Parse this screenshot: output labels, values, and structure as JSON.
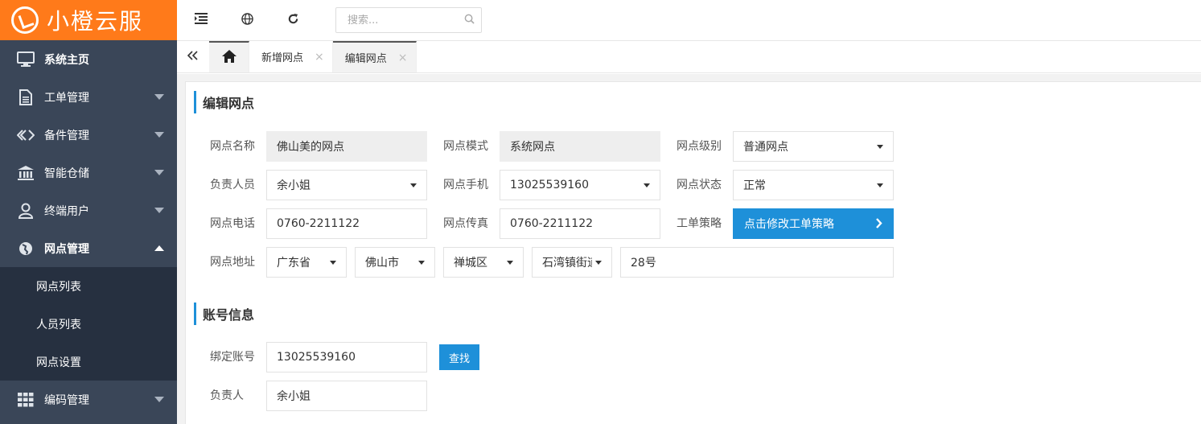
{
  "app": {
    "brand": "小橙云服"
  },
  "sidebar": {
    "items": [
      {
        "label": "系统主页",
        "icon": "monitor-icon",
        "has_caret": false,
        "bold": true
      },
      {
        "label": "工单管理",
        "icon": "document-icon",
        "has_caret": true
      },
      {
        "label": "备件管理",
        "icon": "diamond-link-icon",
        "has_caret": true
      },
      {
        "label": "智能仓储",
        "icon": "bank-icon",
        "has_caret": true
      },
      {
        "label": "终端用户",
        "icon": "user-icon",
        "has_caret": true
      },
      {
        "label": "网点管理",
        "icon": "globe-icon",
        "has_caret": true,
        "expanded": true,
        "bold": true
      },
      {
        "label": "编码管理",
        "icon": "grid-icon",
        "has_caret": true
      }
    ],
    "submenu": [
      {
        "label": "网点列表"
      },
      {
        "label": "人员列表"
      },
      {
        "label": "网点设置"
      }
    ]
  },
  "topbar": {
    "icons": [
      "menu-toggle-icon",
      "globe-icon",
      "refresh-icon"
    ],
    "search_placeholder": "搜索..."
  },
  "tabs": {
    "home_icon": "home-icon",
    "items": [
      {
        "label": "新增网点",
        "active": false
      },
      {
        "label": "编辑网点",
        "active": true
      }
    ]
  },
  "form": {
    "title": "编辑网点",
    "fields": {
      "name_label": "网点名称",
      "name_value": "佛山美的网点",
      "mode_label": "网点模式",
      "mode_value": "系统网点",
      "level_label": "网点级别",
      "level_value": "普通网点",
      "person_label": "负责人员",
      "person_value": "余小姐",
      "phone_label": "网点手机",
      "phone_value": "13025539160",
      "status_label": "网点状态",
      "status_value": "正常",
      "tel_label": "网点电话",
      "tel_value": "0760-2211122",
      "fax_label": "网点传真",
      "fax_value": "0760-2211122",
      "policy_label": "工单策略",
      "policy_button": "点击修改工单策略",
      "address_label": "网点地址",
      "province": "广东省",
      "city": "佛山市",
      "district": "禅城区",
      "street": "石湾镇街道",
      "detail": "28号"
    }
  },
  "account": {
    "title": "账号信息",
    "bind_label": "绑定账号",
    "bind_value": "13025539160",
    "search_button": "查找",
    "owner_label": "负责人",
    "owner_value": "余小姐"
  },
  "colors": {
    "brand": "#ff7a1a",
    "sidebar_bg": "#3a4658",
    "submenu_bg": "#263040",
    "accent": "#1e90d9"
  }
}
